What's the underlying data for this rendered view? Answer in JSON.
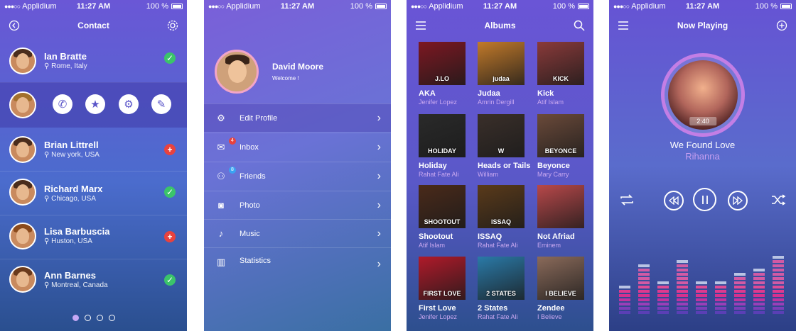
{
  "statusbar": {
    "carrier": "Applidium",
    "time": "11:27 AM",
    "battery": "100 %"
  },
  "contacts_screen": {
    "title": "Contact",
    "contacts": [
      {
        "name": "Ian Bratte",
        "location": "Rome, Italy",
        "status": "✓"
      },
      {
        "name": "Brian Littrell",
        "location": "New york, USA",
        "status": "+"
      },
      {
        "name": "Richard Marx",
        "location": "Chicago, USA",
        "status": "✓"
      },
      {
        "name": "Lisa Barbuscia",
        "location": "Huston, USA",
        "status": "+"
      },
      {
        "name": "Ann Barnes",
        "location": "Montreal, Canada",
        "status": "✓"
      }
    ],
    "actions": [
      "phone-icon",
      "star-icon",
      "gear-icon",
      "edit-icon"
    ],
    "pager_count": 4,
    "pager_active": 1
  },
  "menu_screen": {
    "profile_name": "David Moore",
    "welcome": "Welcome !",
    "items": [
      {
        "label": "Edit Profile",
        "icon": "gear-icon"
      },
      {
        "label": "Inbox",
        "icon": "mail-icon",
        "notif": "4"
      },
      {
        "label": "Friends",
        "icon": "user-icon",
        "notif": "8"
      },
      {
        "label": "Photo",
        "icon": "camera-icon"
      },
      {
        "label": "Music",
        "icon": "mic-icon"
      },
      {
        "label": "Statistics",
        "icon": "chart-icon"
      }
    ]
  },
  "albums_screen": {
    "title": "Albums",
    "albums": [
      {
        "title": "AKA",
        "artist": "Jenifer Lopez",
        "cover_text": "J.LO",
        "color": "#7d1822"
      },
      {
        "title": "Judaa",
        "artist": "Amrin Dergill",
        "cover_text": "judaa",
        "color": "#c27a2a"
      },
      {
        "title": "Kick",
        "artist": "Atif Islam",
        "cover_text": "KICK",
        "color": "#8a3a3a"
      },
      {
        "title": "Holiday",
        "artist": "Rahat Fate Ali",
        "cover_text": "HOLIDAY",
        "color": "#2a2a2a"
      },
      {
        "title": "Heads or Tails",
        "artist": "William",
        "cover_text": "W",
        "color": "#3a2f2a"
      },
      {
        "title": "Beyonce",
        "artist": "Mary Carry",
        "cover_text": "BEYONCE",
        "color": "#6b4a3a"
      },
      {
        "title": "Shootout",
        "artist": "Atif Islam",
        "cover_text": "SHOOTOUT",
        "color": "#4a2a1a"
      },
      {
        "title": "ISSAQ",
        "artist": "Rahat Fate Ali",
        "cover_text": "ISSAQ",
        "color": "#5a3a1a"
      },
      {
        "title": "Not Afriad",
        "artist": "Eminem",
        "cover_text": "",
        "color": "#b8484a"
      },
      {
        "title": "First Love",
        "artist": "Jenifer Lopez",
        "cover_text": "FIRST LOVE",
        "color": "#b01a2a"
      },
      {
        "title": "2 States",
        "artist": "Rahat Fate Ali",
        "cover_text": "2 STATES",
        "color": "#2a7aa8"
      },
      {
        "title": "Zendee",
        "artist": "I Believe",
        "cover_text": "I BELIEVE",
        "color": "#8a6a5a"
      }
    ]
  },
  "player_screen": {
    "title": "Now Playing",
    "time": "2:40",
    "song": "We Found Love",
    "artist": "Rihanna",
    "eq_levels": [
      0.5,
      0.85,
      0.55,
      0.9,
      0.6,
      0.55,
      0.7,
      0.8,
      1.0
    ]
  }
}
